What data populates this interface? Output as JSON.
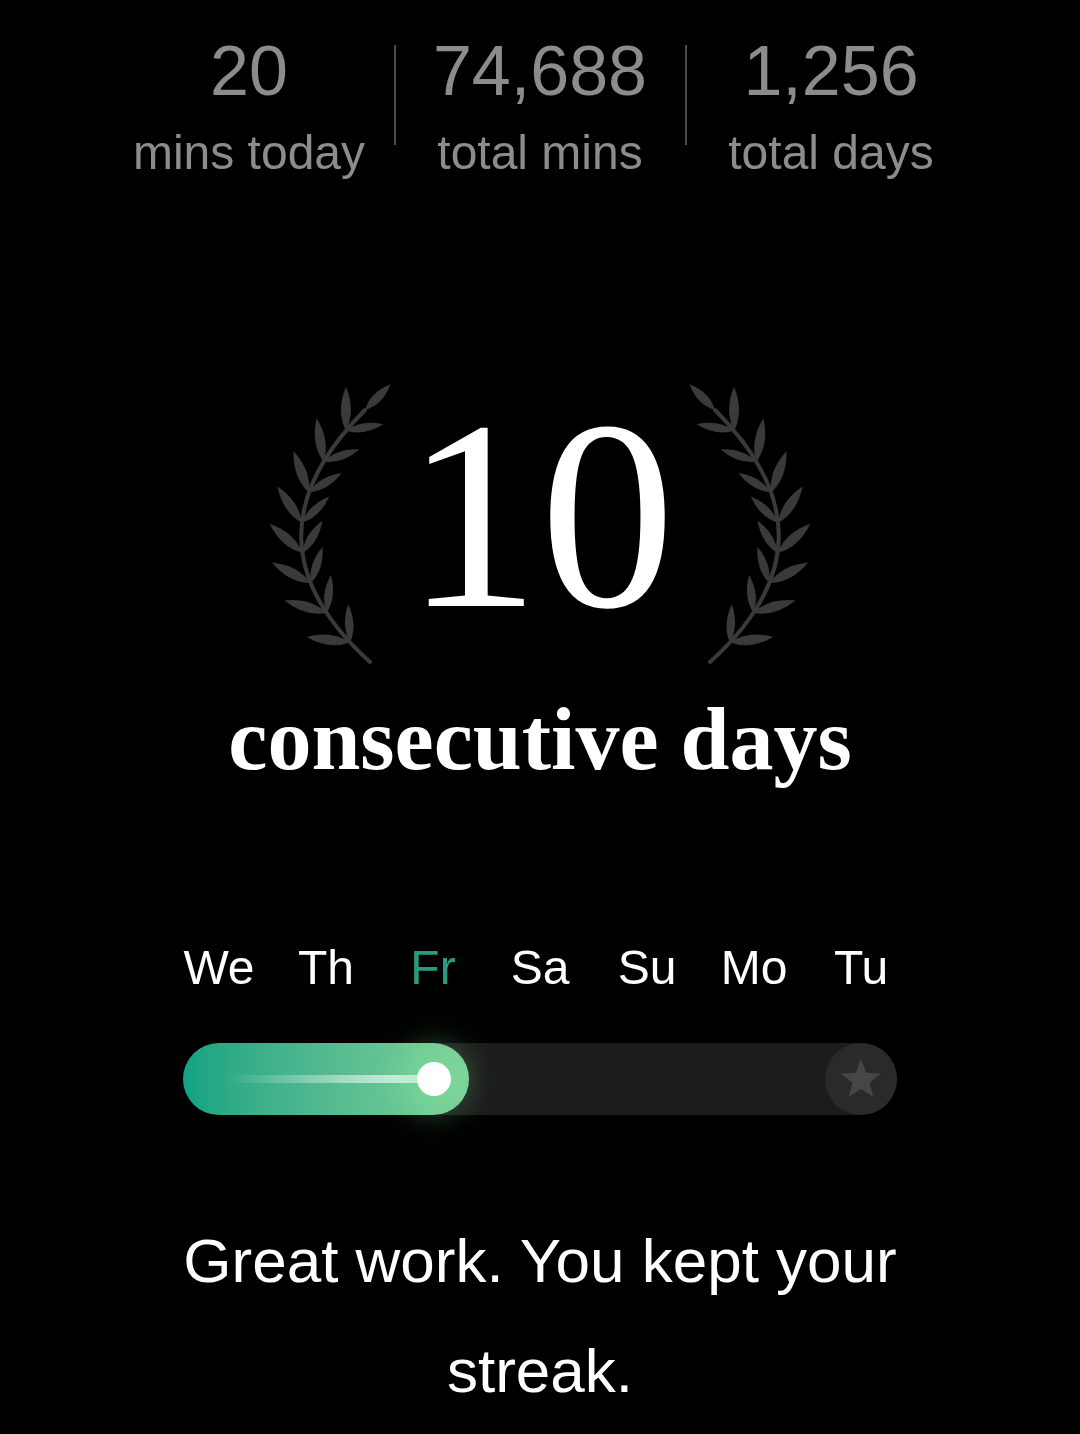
{
  "stats": [
    {
      "value": "20",
      "label": "mins today"
    },
    {
      "value": "74,688",
      "label": "total mins"
    },
    {
      "value": "1,256",
      "label": "total days"
    }
  ],
  "streak": {
    "count": "10",
    "label": "consecutive days"
  },
  "week": {
    "days": [
      {
        "label": "We",
        "selected": false
      },
      {
        "label": "Th",
        "selected": false
      },
      {
        "label": "Fr",
        "selected": true
      },
      {
        "label": "Sa",
        "selected": false
      },
      {
        "label": "Su",
        "selected": false
      },
      {
        "label": "Mo",
        "selected": false
      },
      {
        "label": "Tu",
        "selected": false
      }
    ],
    "progress": {
      "level": 0.4
    }
  },
  "message": "Great work. You kept your streak."
}
